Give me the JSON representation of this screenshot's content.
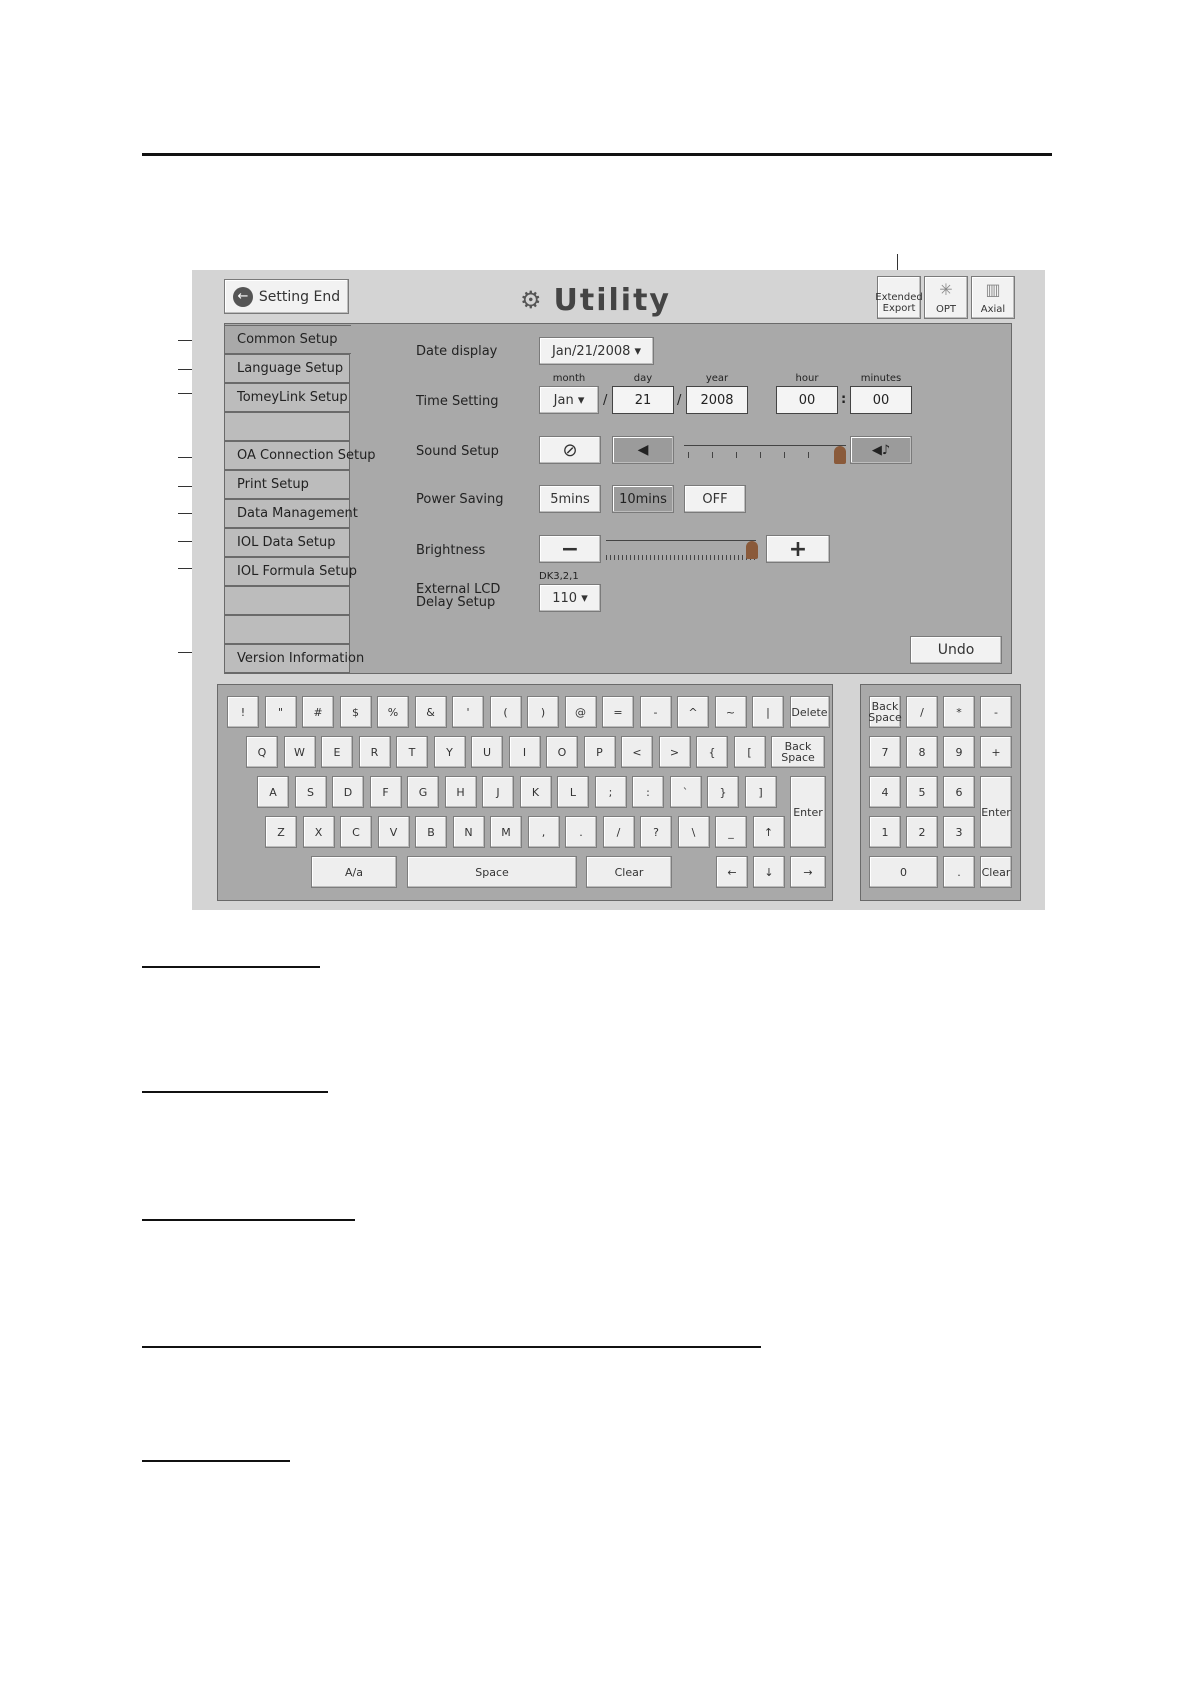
{
  "header": {
    "setting_end_label": "Setting End",
    "title": "Utility",
    "extended_export_label": "Extended Export",
    "opt_label": "OPT",
    "axial_label": "Axial"
  },
  "tabs": [
    {
      "label": "Common Setup"
    },
    {
      "label": "Language Setup"
    },
    {
      "label": "TomeyLink Setup"
    },
    {
      "label": ""
    },
    {
      "label": "OA Connection Setup"
    },
    {
      "label": "Print Setup"
    },
    {
      "label": "Data Management"
    },
    {
      "label": "IOL Data Setup"
    },
    {
      "label": "IOL Formula Setup"
    },
    {
      "label": ""
    },
    {
      "label": ""
    },
    {
      "label": "Version Information"
    }
  ],
  "settings": {
    "date_display": {
      "label": "Date display",
      "value": "Jan/21/2008 ▾"
    },
    "time_setting": {
      "label": "Time Setting",
      "month_caption": "month",
      "day_caption": "day",
      "year_caption": "year",
      "hour_caption": "hour",
      "minutes_caption": "minutes",
      "month": "Jan ▾",
      "day": "21",
      "year": "2008",
      "hour": "00",
      "minutes": "00",
      "sep_slash": "/",
      "sep_colon": ":"
    },
    "sound_setup": {
      "label": "Sound Setup"
    },
    "power_saving": {
      "label": "Power Saving",
      "options": [
        "5mins",
        "10mins",
        "OFF"
      ],
      "selected": "10mins"
    },
    "brightness": {
      "label": "Brightness",
      "minus": "−",
      "plus": "+"
    },
    "external_lcd": {
      "label_line1": "External LCD",
      "label_line2": "Delay Setup",
      "caption": "DK3,2,1",
      "value": "110 ▾"
    },
    "undo_label": "Undo"
  },
  "keyboard": {
    "row1": [
      "!",
      "\"",
      "#",
      "$",
      "%",
      "&",
      "'",
      "(",
      ")",
      "@",
      "=",
      "-",
      "^",
      "~",
      "|",
      "Delete"
    ],
    "row2": [
      "Q",
      "W",
      "E",
      "R",
      "T",
      "Y",
      "U",
      "I",
      "O",
      "P",
      "<",
      ">",
      "{",
      "[",
      "Back Space"
    ],
    "row3": [
      "A",
      "S",
      "D",
      "F",
      "G",
      "H",
      "J",
      "K",
      "L",
      ";",
      ":",
      "`",
      "}",
      "]"
    ],
    "row4": [
      "Z",
      "X",
      "C",
      "V",
      "B",
      "N",
      "M",
      ",",
      ".",
      "/",
      "?",
      "\\",
      "_",
      "↑"
    ],
    "enter": "Enter",
    "row5": [
      "A/a",
      "Space",
      "Clear",
      "←",
      "↓",
      "→"
    ]
  },
  "numpad": {
    "row1": [
      "Back Space",
      "/",
      "*",
      "-"
    ],
    "row2": [
      "7",
      "8",
      "9",
      "+"
    ],
    "row3": [
      "4",
      "5",
      "6"
    ],
    "row4": [
      "1",
      "2",
      "3"
    ],
    "row5": [
      "0",
      "."
    ],
    "enter": "Enter",
    "clear": "Clear"
  },
  "colors": {
    "panel": "#a9a9a9",
    "screen_bg": "#d4d4d4",
    "key": "#eeeeee"
  }
}
